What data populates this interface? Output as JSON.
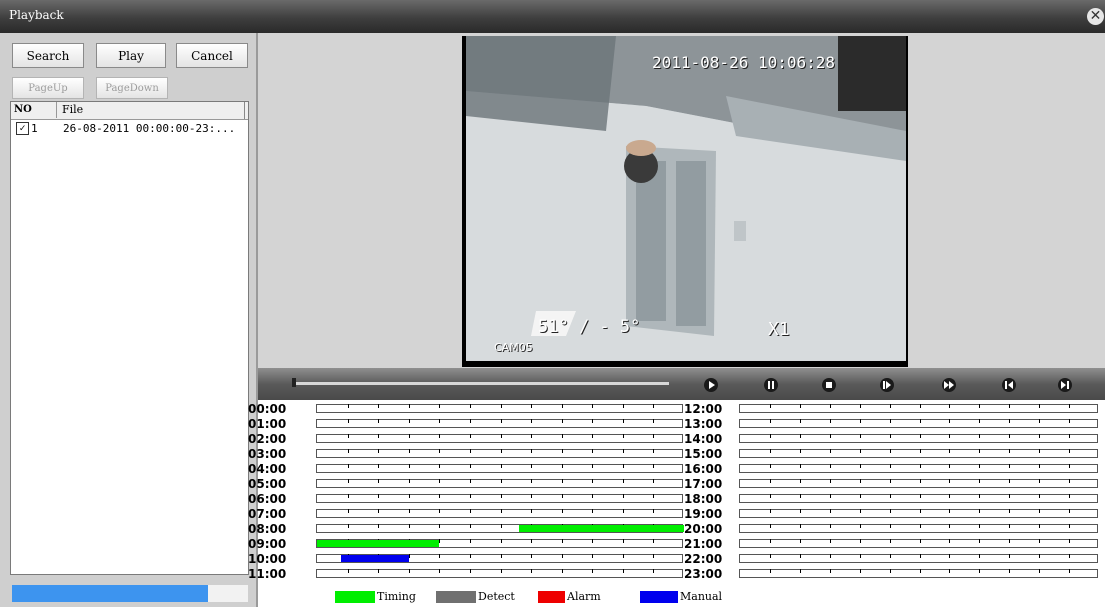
{
  "window": {
    "title": "Playback",
    "close_glyph": "✕"
  },
  "buttons": {
    "search": "Search",
    "play": "Play",
    "cancel": "Cancel",
    "page_up": "PageUp",
    "page_down": "PageDown"
  },
  "filelist": {
    "headers": {
      "no": "NO",
      "file": "File"
    },
    "rows": [
      {
        "no": "1",
        "file": "26-08-2011 00:00:00-23:...",
        "checked": true
      }
    ]
  },
  "search_progress": 0.83,
  "video": {
    "timestamp": "2011-08-26 10:06:28",
    "camera": "CAM05",
    "speed": "X1",
    "ptz": "51° / - 5°"
  },
  "controls": [
    "play-icon",
    "pause-icon",
    "stop-icon",
    "slow-icon",
    "fast-forward-icon",
    "previous-frame-icon",
    "next-frame-icon"
  ],
  "timeline": {
    "left_hours": [
      "00:00",
      "01:00",
      "02:00",
      "03:00",
      "04:00",
      "05:00",
      "06:00",
      "07:00",
      "08:00",
      "09:00",
      "10:00",
      "11:00"
    ],
    "right_hours": [
      "12:00",
      "13:00",
      "14:00",
      "15:00",
      "16:00",
      "17:00",
      "18:00",
      "19:00",
      "20:00",
      "21:00",
      "22:00",
      "23:00"
    ],
    "segments": [
      {
        "hour": 8,
        "start_min": 33,
        "end_min": 60,
        "type": "timing"
      },
      {
        "hour": 9,
        "start_min": 0,
        "end_min": 20,
        "type": "timing"
      },
      {
        "hour": 10,
        "start_min": 4,
        "end_min": 15,
        "type": "manual"
      }
    ]
  },
  "legend": [
    {
      "label": "Timing",
      "color": "#00ee00",
      "type": "timing"
    },
    {
      "label": "Detect",
      "color": "#707070",
      "type": "detect"
    },
    {
      "label": "Alarm",
      "color": "#ee0000",
      "type": "alarm"
    },
    {
      "label": "Manual",
      "color": "#0000ee",
      "type": "manual"
    }
  ]
}
